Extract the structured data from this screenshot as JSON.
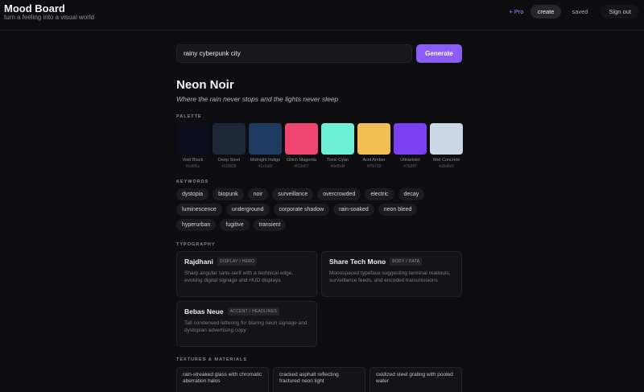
{
  "app": {
    "title": "Mood Board",
    "subtitle": "turn a feeling into a visual world"
  },
  "nav": {
    "pro": "+ Pro",
    "create": "create",
    "saved": "saved",
    "signout": "Sign out"
  },
  "search": {
    "value": "rainy cyberpunk city",
    "button": "Generate"
  },
  "theme": {
    "title": "Neon Noir",
    "tagline": "Where the rain never stops and the lights never sleep"
  },
  "sections": {
    "palette": "PALETTE",
    "keywords": "KEYWORDS",
    "typography": "TYPOGRAPHY",
    "textures": "TEXTURES & MATERIALS"
  },
  "palette": [
    {
      "name": "Void Black",
      "hex": "#0d0f1c",
      "color": "#0d0f1c"
    },
    {
      "name": "Deep Steel",
      "hex": "#1f2838",
      "color": "#1f2838"
    },
    {
      "name": "Midnight Indigo",
      "hex": "#1e3a5f",
      "color": "#1e3a5f"
    },
    {
      "name": "Glitch Magenta",
      "hex": "#f12d67",
      "color": "#ee4671"
    },
    {
      "name": "Toxic Cyan",
      "hex": "#6ef5d4",
      "color": "#6ef0d4"
    },
    {
      "name": "Acid Amber",
      "hex": "#f7b733",
      "color": "#f0be54"
    },
    {
      "name": "Ultraviolet",
      "hex": "#7b2ff7",
      "color": "#7b3ff2"
    },
    {
      "name": "Wet Concrete",
      "hex": "#c8d6e5",
      "color": "#cbd7e4"
    }
  ],
  "keywords": [
    "dystopia",
    "biopunk",
    "noir",
    "surveillance",
    "overcrowded",
    "electric",
    "decay",
    "luminescence",
    "underground",
    "corporate shadow",
    "rain-soaked",
    "neon bleed",
    "hyperurban",
    "fugitive",
    "transient"
  ],
  "typography": [
    {
      "name": "Rajdhani",
      "role": "DISPLAY / HERO",
      "desc": "Sharp angular sans-serif with a technical edge, evoking digital signage and HUD displays"
    },
    {
      "name": "Share Tech Mono",
      "role": "BODY / DATA",
      "desc": "Monospaced typeface suggesting terminal readouts, surveillance feeds, and encoded transmissions"
    },
    {
      "name": "Bebas Neue",
      "role": "ACCENT / HEADLINES",
      "desc": "Tall condensed lettering for blaring neon signage and dystopian advertising copy"
    }
  ],
  "textures": [
    "rain-streaked glass with chromatic aberration halos",
    "cracked asphalt reflecting fractured neon light",
    "oxidized steel grating with pooled water"
  ]
}
